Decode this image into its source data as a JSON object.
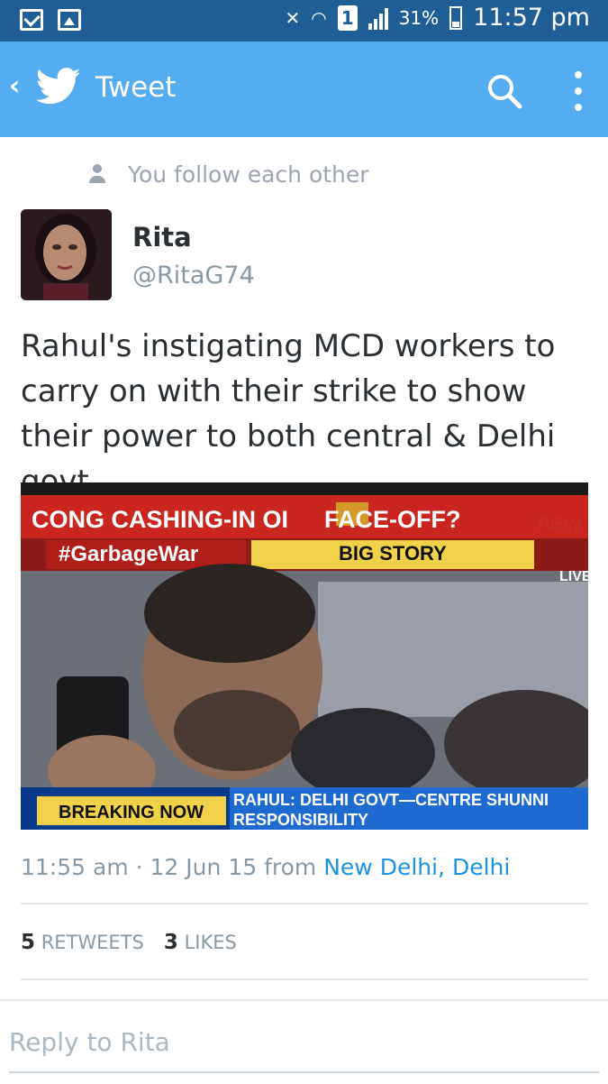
{
  "status_bar": {
    "battery": "31%",
    "time": "11:57 pm",
    "sim": "1",
    "icons": [
      "mail-icon",
      "gallery-icon",
      "mute-icon",
      "wifi-icon",
      "signal-icon",
      "battery-icon"
    ]
  },
  "app_bar": {
    "back_icon": "back-chevron-icon",
    "title": "Tweet",
    "actions": [
      "search-icon",
      "overflow-menu-icon"
    ],
    "color": "#55acee"
  },
  "follow_status": "You follow each other",
  "author": {
    "name": "Rita",
    "handle": "@RitaG74"
  },
  "tweet": {
    "text": "Rahul's instigating MCD workers to carry on with their strike to show their power to both central & Delhi govt."
  },
  "media": {
    "headline": "CONG CASHING-IN OI",
    "headline_end": "FACE-OFF?",
    "headline_suffix": "new",
    "hashtag": "#GarbageWar",
    "tag": "BIG STORY",
    "live": "LIVE",
    "breaking": "BREAKING NOW",
    "ticker_line1": "RAHUL: DELHI GOVT—CENTRE SHUNNI",
    "ticker_line2": "RESPONSIBILITY"
  },
  "meta": {
    "time": "11:55 am",
    "separator": "·",
    "date": "12 Jun 15",
    "from": "from",
    "location": "New Delhi, Delhi"
  },
  "stats": {
    "retweets_count": "5",
    "retweets_label": "RETWEETS",
    "likes_count": "3",
    "likes_label": "LIKES"
  },
  "reply": {
    "placeholder": "Reply to Rita"
  }
}
